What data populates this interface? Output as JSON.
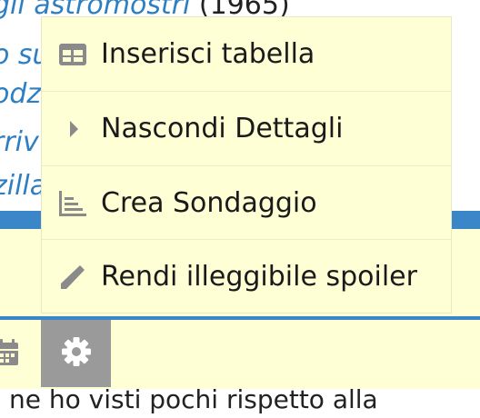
{
  "background": {
    "lines": [
      {
        "link": "gli astromostri",
        "rest": " (1965)"
      },
      {
        "link": "o su",
        "rest": ""
      },
      {
        "link": "odz",
        "rest": ""
      },
      {
        "link": "rriv",
        "rest": ""
      },
      {
        "link": "zilla",
        "rest": ""
      }
    ],
    "bottom_text": "ne ho visti pochi rispetto alla"
  },
  "menu": {
    "items": [
      {
        "label": "Inserisci tabella",
        "icon": "table-icon"
      },
      {
        "label": "Nascondi Dettagli",
        "icon": "caret-right-icon"
      },
      {
        "label": "Crea Sondaggio",
        "icon": "chart-icon"
      },
      {
        "label": "Rendi illeggibile spoiler",
        "icon": "pencil-icon"
      }
    ]
  },
  "toolbar": {
    "icons": [
      "calendar-icon",
      "gear-icon"
    ]
  },
  "colors": {
    "menu_bg": "#ffffd6",
    "link_blue": "#2e7fc2",
    "accent_bar": "#3a86c8",
    "gear_button_bg": "#9a9a9a",
    "icon_gray": "#8a8a8a"
  }
}
